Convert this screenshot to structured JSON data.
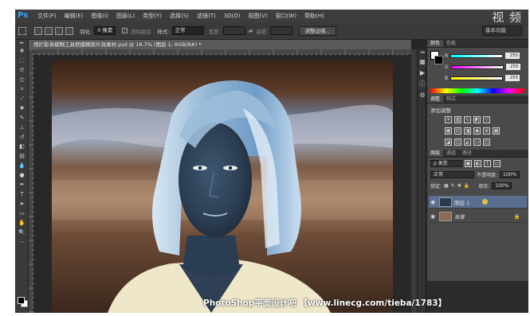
{
  "app": {
    "logo": "Ps",
    "watermark": "视 频"
  },
  "menu": [
    "文件(F)",
    "编辑(E)",
    "图像(I)",
    "图层(L)",
    "类型(Y)",
    "选择(S)",
    "滤镜(T)",
    "3D(D)",
    "视图(V)",
    "窗口(W)",
    "帮助(H)"
  ],
  "options": {
    "feather_label": "羽化:",
    "feather_value": "0 像素",
    "antialias_label": "消除锯齿",
    "style_label": "样式:",
    "style_value": "正常",
    "width_label": "宽度:",
    "height_label": "高度:",
    "refine_button": "调整边缘...",
    "workspace": "基本功能"
  },
  "document": {
    "tab_title": "用於影表模糊工具把模糊部片效果材.psd @ 16.7% (图层 1, RGB/8#) *"
  },
  "panels": {
    "color_tabs": [
      "颜色",
      "色板"
    ],
    "color": {
      "channels": [
        {
          "label": "R",
          "value": "255"
        },
        {
          "label": "G",
          "value": "255"
        },
        {
          "label": "B",
          "value": "255"
        }
      ]
    },
    "adjust_tabs": [
      "调整",
      "样式"
    ],
    "adjust_title": "添加调整",
    "layers_tabs": [
      "图层",
      "通道",
      "路径"
    ],
    "layers": {
      "kind_label": "ρ 类型",
      "blend_mode": "正常",
      "opacity_label": "不透明度:",
      "opacity_value": "100%",
      "lock_label": "锁定:",
      "fill_label": "填充:",
      "fill_value": "100%",
      "items": [
        {
          "name": "图层 1",
          "active": true
        },
        {
          "name": "背景",
          "active": false
        }
      ]
    }
  },
  "caption": "PhotoShop平面设计吧 【www.linecg.com/tieba/1783】"
}
